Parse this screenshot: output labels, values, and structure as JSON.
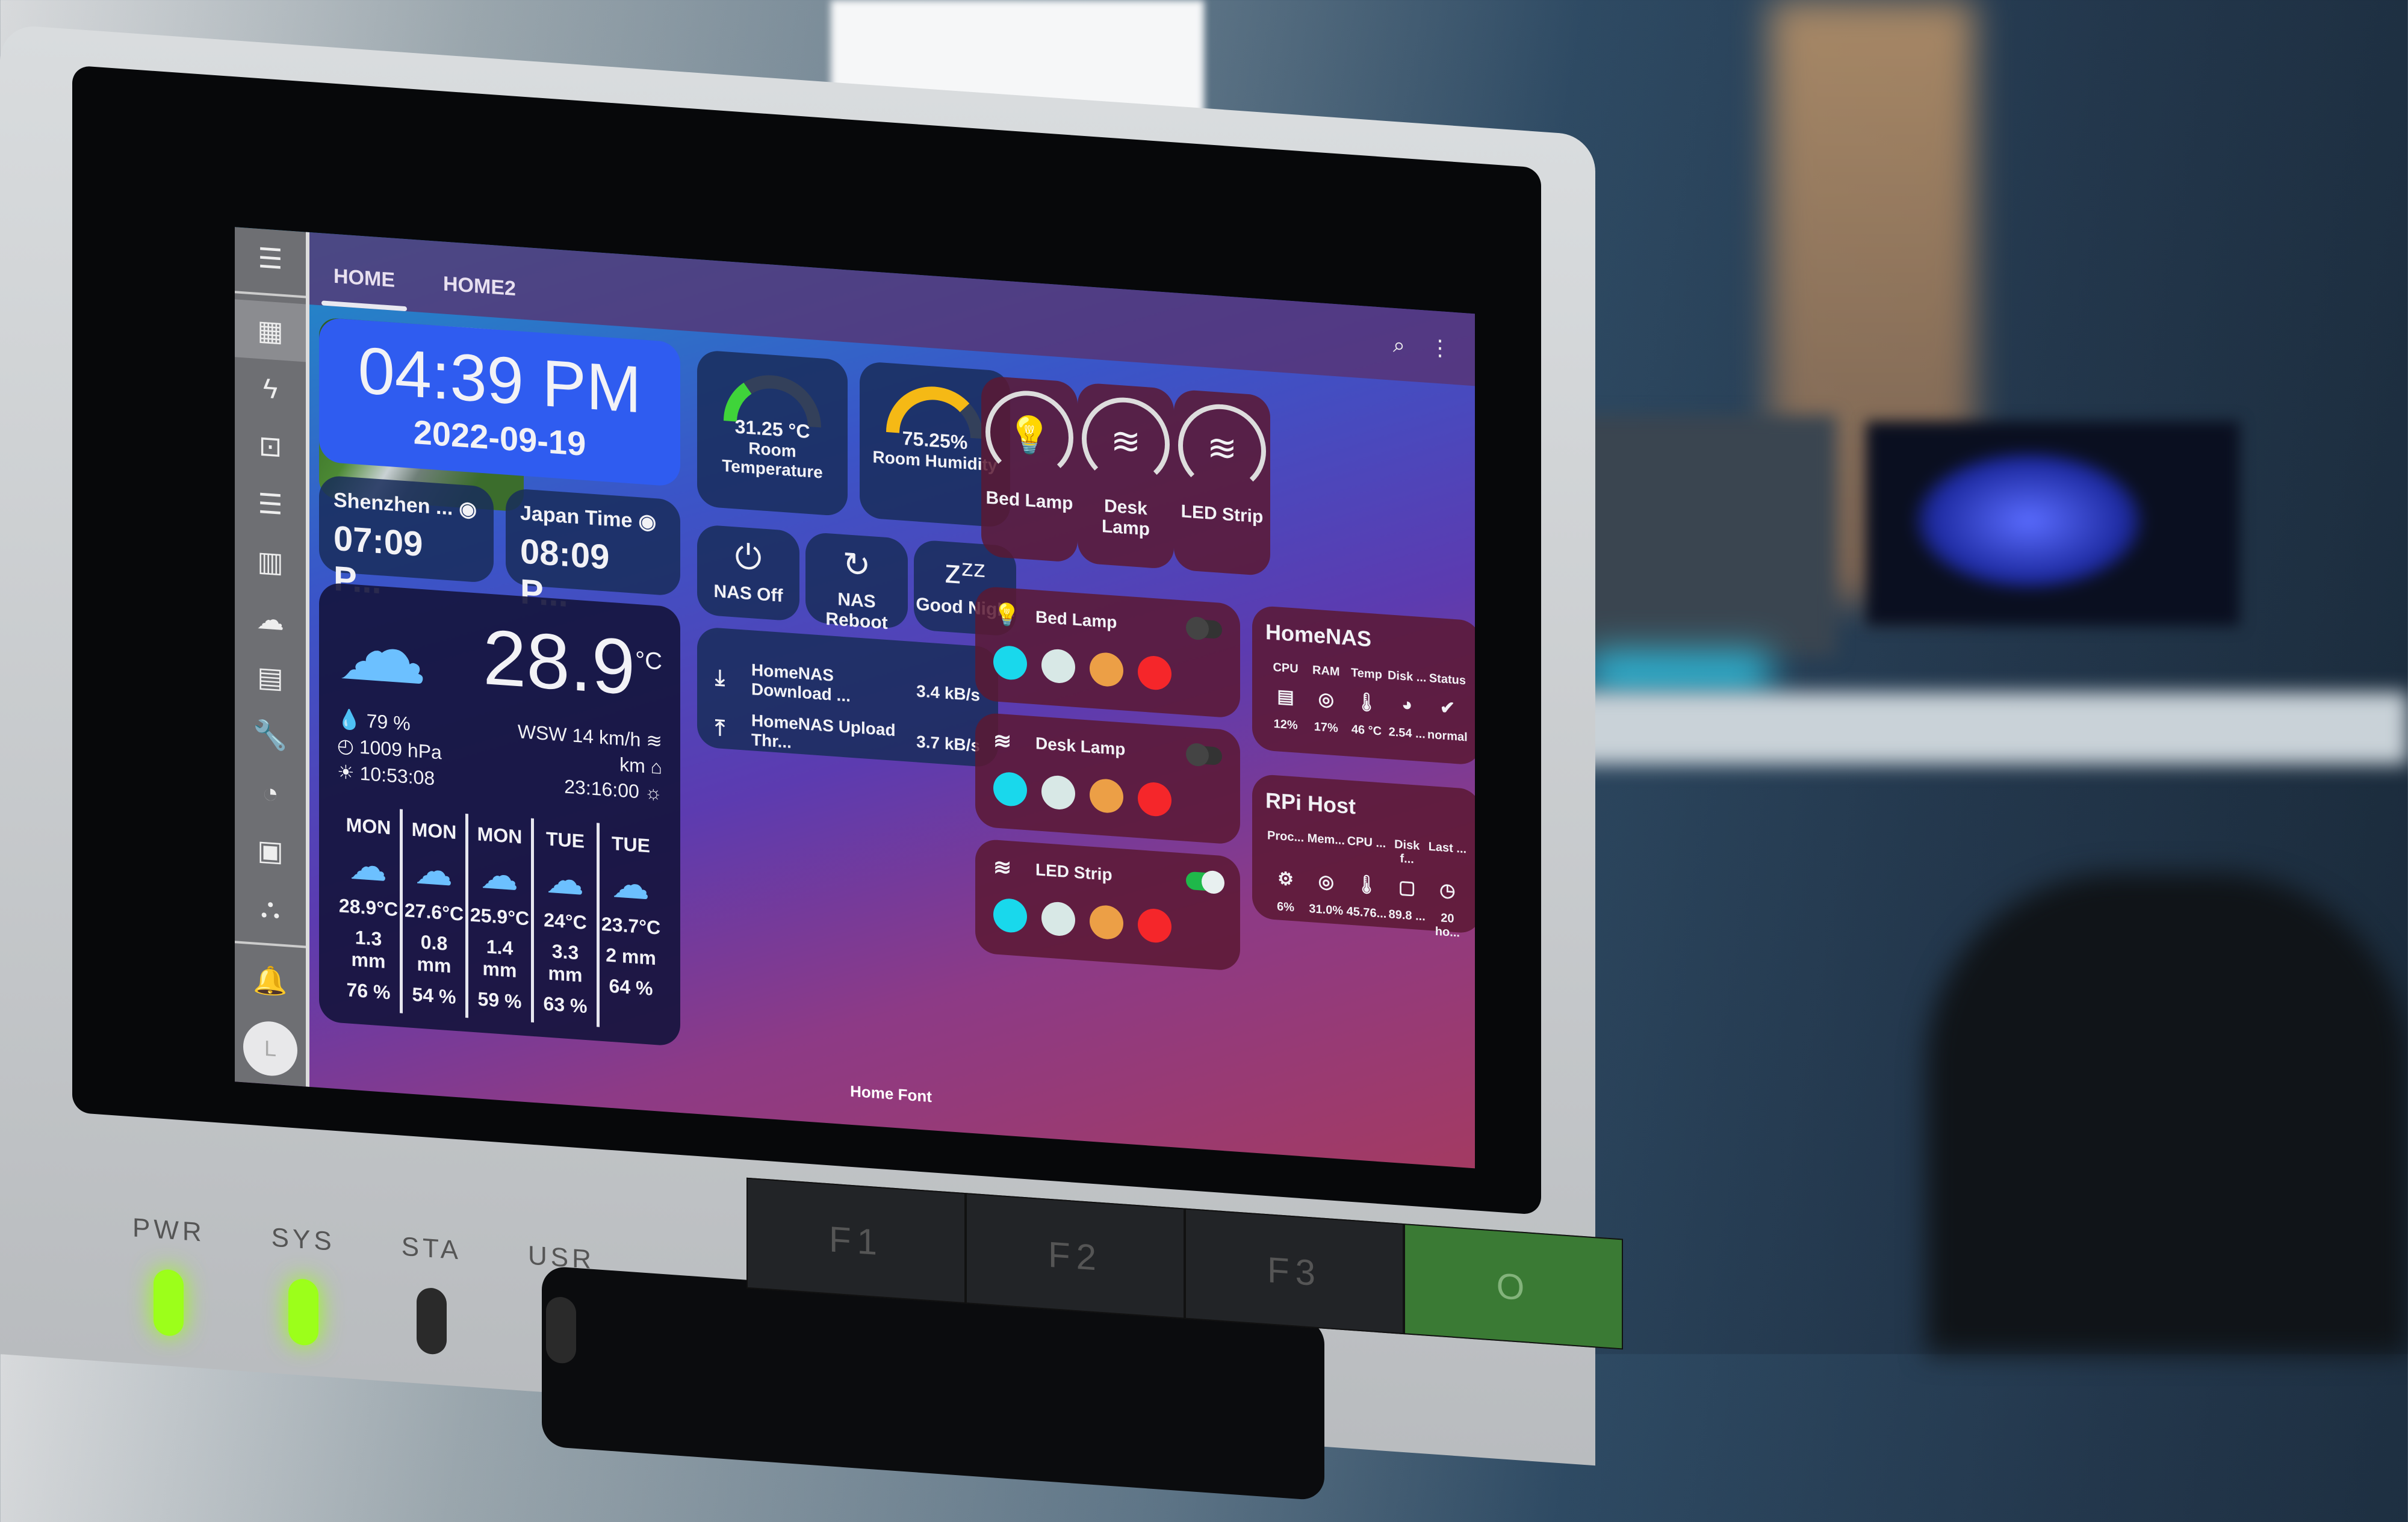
{
  "device": {
    "leds": [
      {
        "label": "PWR",
        "on": true
      },
      {
        "label": "SYS",
        "on": true
      },
      {
        "label": "STA",
        "on": false
      },
      {
        "label": "USR",
        "on": false
      }
    ],
    "buttons": [
      "F1",
      "F2",
      "F3",
      "O"
    ]
  },
  "sidebar": {
    "menu_icon": "menu-icon",
    "items": [
      {
        "icon": "dashboard-icon",
        "glyph": "▦",
        "active": true
      },
      {
        "icon": "lightning-icon",
        "glyph": "ϟ"
      },
      {
        "icon": "person-badge-icon",
        "glyph": "⊡"
      },
      {
        "icon": "list-icon",
        "glyph": "☰"
      },
      {
        "icon": "chart-icon",
        "glyph": "▥"
      },
      {
        "icon": "cloud-icon",
        "glyph": "☁"
      },
      {
        "icon": "server-icon",
        "glyph": "▤"
      },
      {
        "icon": "wrench-icon",
        "glyph": "🔧"
      },
      {
        "icon": "gauge-icon",
        "glyph": "◔"
      },
      {
        "icon": "storage-icon",
        "glyph": "▣"
      },
      {
        "icon": "network-icon",
        "glyph": "⛬"
      }
    ],
    "notification_icon": "bell-icon",
    "avatar_initial": "L"
  },
  "header": {
    "tabs": [
      {
        "label": "HOME",
        "active": true
      },
      {
        "label": "HOME2"
      }
    ],
    "search_icon": "⌕",
    "more_icon": "⋮"
  },
  "clock": {
    "time": "04:39 PM",
    "date": "2022-09-19"
  },
  "world_clocks": [
    {
      "city": "Shenzhen ...",
      "time": "07:09 P..."
    },
    {
      "city": "Japan Time",
      "time": "08:09 P..."
    }
  ],
  "weather": {
    "current_temp": "28.9",
    "unit": "°C",
    "humidity": "79",
    "humidity_unit": "%",
    "pressure": "1009",
    "pressure_unit": "hPa",
    "sunrise": "10:53:08",
    "wind": "WSW 14",
    "wind_unit": "km/h",
    "visibility_unit": "km",
    "sunset": "23:16:00",
    "forecast": [
      {
        "day": "MON",
        "temp": "28.9°C",
        "precip": "1.3 mm",
        "prob": "76 %"
      },
      {
        "day": "MON",
        "temp": "27.6°C",
        "precip": "0.8 mm",
        "prob": "54 %"
      },
      {
        "day": "MON",
        "temp": "25.9°C",
        "precip": "1.4 mm",
        "prob": "59 %"
      },
      {
        "day": "TUE",
        "temp": "24°C",
        "precip": "3.3 mm",
        "prob": "63 %"
      },
      {
        "day": "TUE",
        "temp": "23.7°C",
        "precip": "2 mm",
        "prob": "64 %"
      }
    ]
  },
  "gauges": [
    {
      "value": "31.25 °C",
      "label": "Room Temperature",
      "fraction": 0.3,
      "color": "#3fd43a"
    },
    {
      "value": "75.25%",
      "label": "Room Humidity",
      "fraction": 0.75,
      "color": "#f5b915"
    }
  ],
  "actions": [
    {
      "label": "NAS Off",
      "glyph": "⏻"
    },
    {
      "label": "NAS Reboot",
      "glyph": "↻"
    },
    {
      "label": "Good Night",
      "glyph": "zᶻᶻ"
    }
  ],
  "network": [
    {
      "name": "HomeNAS Download ...",
      "value": "3.4 kB/s",
      "glyph": "⤓"
    },
    {
      "name": "HomeNAS Upload Thr...",
      "value": "3.7 kB/s",
      "glyph": "⤒"
    }
  ],
  "light_tiles": [
    {
      "label": "Bed Lamp",
      "glyph": "💡"
    },
    {
      "label": "Desk Lamp",
      "glyph": "≋"
    },
    {
      "label": "LED Strip",
      "glyph": "≋"
    }
  ],
  "camera": {
    "label": "Home Font"
  },
  "lights": [
    {
      "name": "Bed Lamp",
      "glyph": "💡",
      "on": false
    },
    {
      "name": "Desk Lamp",
      "glyph": "≋",
      "on": false
    },
    {
      "name": "LED Strip",
      "glyph": "≋",
      "on": true
    }
  ],
  "swatch_colors": [
    "#19d8ec",
    "#d8e8e6",
    "#ec9f46",
    "#f5262a"
  ],
  "homenas": {
    "title": "HomeNAS",
    "stats": [
      {
        "label": "CPU",
        "value": "12%",
        "glyph": "▤"
      },
      {
        "label": "RAM",
        "value": "17%",
        "glyph": "◎"
      },
      {
        "label": "Temp",
        "value": "46 °C",
        "glyph": "🌡"
      },
      {
        "label": "Disk ...",
        "value": "2.54 ...",
        "glyph": "◕"
      },
      {
        "label": "Status",
        "value": "normal",
        "glyph": "✔"
      }
    ]
  },
  "rpi": {
    "title": "RPi Host",
    "stats": [
      {
        "label": "Proc...",
        "value": "6%",
        "glyph": "⚙"
      },
      {
        "label": "Mem...",
        "value": "31.0%",
        "glyph": "◎"
      },
      {
        "label": "CPU ...",
        "value": "45.76...",
        "glyph": "🌡"
      },
      {
        "label": "Disk f...",
        "value": "89.8 ...",
        "glyph": "▢"
      },
      {
        "label": "Last ...",
        "value": "20 ho...",
        "glyph": "◷"
      }
    ]
  }
}
